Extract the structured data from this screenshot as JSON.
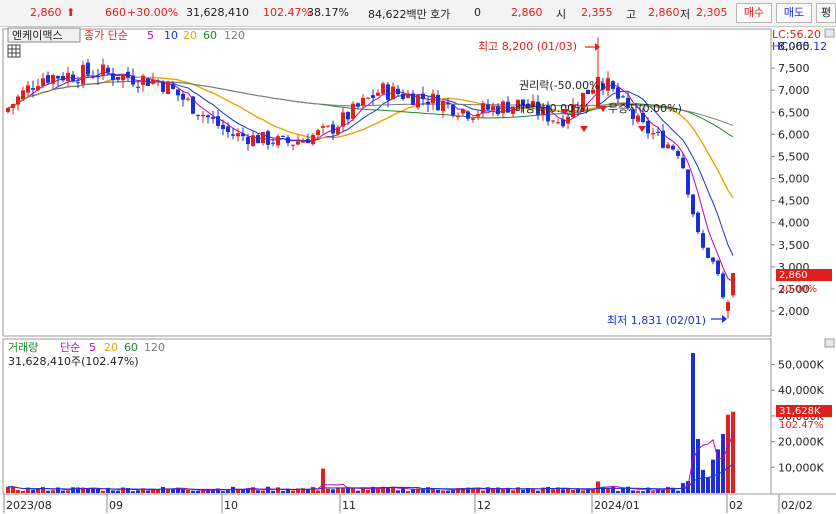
{
  "topbar": {
    "price": "2,860",
    "change": "660",
    "change_pct": "+30.00%",
    "volume": "31,628,410",
    "volume_ratio": "102.47%",
    "turnover": "38.17%",
    "amount": "84,622백만",
    "quote_label": "호가",
    "quote_value": "0",
    "quote_price": "2,860",
    "open_label": "시",
    "open": "2,355",
    "high_label": "고",
    "high": "2,860",
    "low_label": "저",
    "low": "2,305",
    "buy_label": "매수",
    "sell_label": "매도",
    "extra_label": "평"
  },
  "colors": {
    "up": "#e0201c",
    "down": "#1a2fd6",
    "ma5": "#c000c0",
    "ma10": "#1a2fd6",
    "ma20": "#e8a400",
    "ma60": "#1a8a2a",
    "ma120": "#7a7a7a"
  },
  "price_panel": {
    "stock_name": "엔케이맥스",
    "legend_prefix": "종가 단순",
    "ma_periods": [
      "5",
      "10",
      "20",
      "60",
      "120"
    ],
    "lc": "LC:56.20",
    "hc": "HC:-65.12",
    "max_label": "최고 8,200 (01/03)",
    "min_label": "최저 1,831 (02/01)",
    "events": [
      "권리락(-50.00%)",
      "배당락(0.00%)",
      "무증자(0.00%)"
    ],
    "current_price_tag": "2,860",
    "current_pct_tag": "30.00%"
  },
  "volume_panel": {
    "title": "거래량",
    "legend_prefix": "단순",
    "ma_periods": [
      "5",
      "20",
      "60",
      "120"
    ],
    "info": "31,628,410주(102.47%)",
    "current_tag": "31,628K",
    "current_pct": "102.47%"
  },
  "chart_data": [
    {
      "type": "candlestick",
      "title": "엔케이맥스",
      "y_ticks": [
        "2,000",
        "2,500",
        "3,000",
        "3,500",
        "4,000",
        "4,500",
        "5,000",
        "5,500",
        "6,000",
        "6,500",
        "7,000",
        "7,500",
        "8,000"
      ],
      "ylim": [
        1700,
        8500
      ],
      "x_ticks": [
        "2023/08",
        "09",
        "10",
        "11",
        "12",
        "2024/01",
        "02",
        "02/02"
      ],
      "close_points": [
        {
          "date": "2023/08",
          "close": 6600
        },
        {
          "date": "2023/08",
          "close": 7300
        },
        {
          "date": "2023/09",
          "close": 7400
        },
        {
          "date": "2023/09",
          "close": 7200
        },
        {
          "date": "2023/10",
          "close": 6000
        },
        {
          "date": "2023/10",
          "close": 5800
        },
        {
          "date": "2023/11",
          "close": 6200
        },
        {
          "date": "2023/11",
          "close": 7000
        },
        {
          "date": "2023/12",
          "close": 6700
        },
        {
          "date": "2023/12",
          "close": 6500
        },
        {
          "date": "2024/01/03",
          "close": 7300
        },
        {
          "date": "2024/01",
          "close": 6200
        },
        {
          "date": "2024/01",
          "close": 4200
        },
        {
          "date": "2024/02/01",
          "close": 2200
        },
        {
          "date": "2024/02/02",
          "close": 2860
        }
      ],
      "high": {
        "value": 8200,
        "date": "01/03"
      },
      "low": {
        "value": 1831,
        "date": "02/01"
      }
    },
    {
      "type": "bar",
      "title": "거래량",
      "y_ticks": [
        "10,000K",
        "20,000K",
        "30,000K",
        "40,000K",
        "50,000K"
      ],
      "ylim": [
        0,
        57000
      ],
      "unit": "K",
      "spike_values": [
        {
          "date": "2024/01 late",
          "value": 54500
        },
        {
          "date": "2024/02/01",
          "value": 30500
        },
        {
          "date": "2024/02/02",
          "value": 31628
        }
      ]
    }
  ]
}
